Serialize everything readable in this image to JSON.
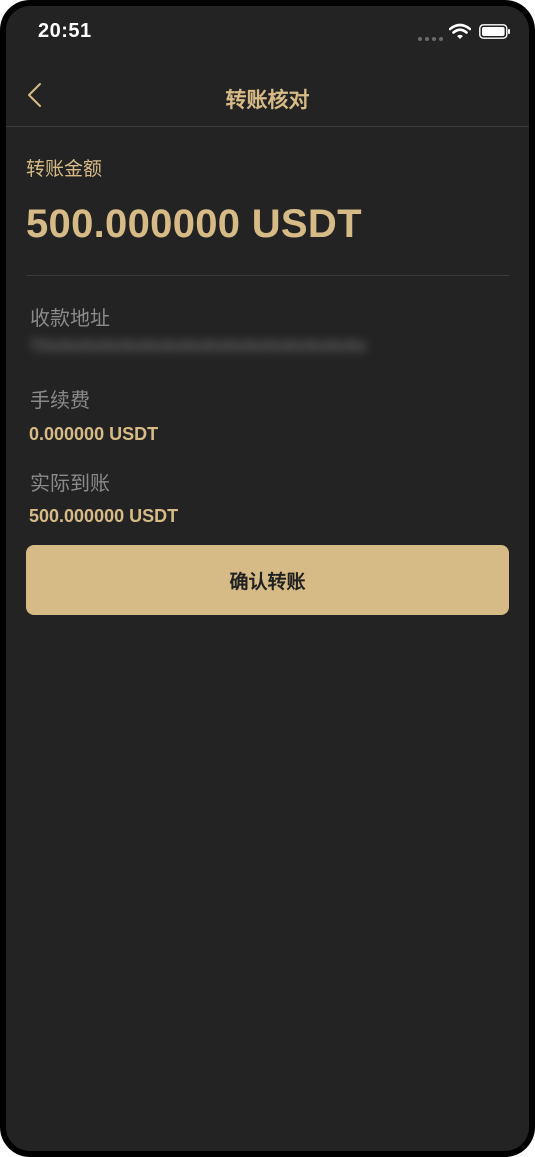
{
  "status_bar": {
    "time": "20:51",
    "icons": [
      "signal-dots-icon",
      "wifi-icon",
      "battery-icon"
    ]
  },
  "nav": {
    "back_icon": "chevron-left-icon",
    "title": "转账核对"
  },
  "amount": {
    "label": "转账金额",
    "value": "500.000000 USDT"
  },
  "recipient": {
    "label": "收款地址",
    "value": "TXxXxXxXxXxXxXxXxXxXxXxXxXxXxXxXx"
  },
  "fee": {
    "label": "手续费",
    "value": "0.000000 USDT"
  },
  "actual": {
    "label": "实际到账",
    "value": "500.000000 USDT"
  },
  "confirm_button": {
    "label": "确认转账"
  },
  "colors": {
    "background": "#232323",
    "accent": "#d7bb87",
    "muted_text": "#8a8a8a",
    "divider": "#3a3a3a"
  }
}
